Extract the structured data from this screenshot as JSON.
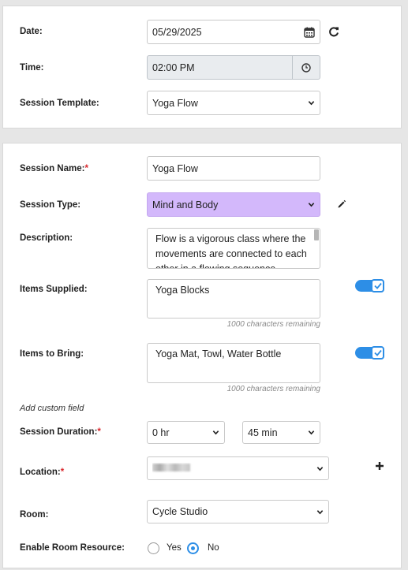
{
  "date": {
    "label": "Date:",
    "value": "05/29/2025"
  },
  "time": {
    "label": "Time:",
    "value": "02:00 PM"
  },
  "template": {
    "label": "Session Template:",
    "value": "Yoga Flow"
  },
  "session_name": {
    "label": "Session Name:",
    "required": "*",
    "value": "Yoga Flow"
  },
  "session_type": {
    "label": "Session Type:",
    "value": "Mind and Body",
    "highlight_color": "#d3b8fb"
  },
  "description": {
    "label": "Description:",
    "value": "Flow is a vigorous class where the movements are connected to each other in a flowing sequence synchronized with the breath."
  },
  "items_supplied": {
    "label": "Items Supplied:",
    "value": "Yoga Blocks",
    "remaining": "1000 characters remaining",
    "enabled": true
  },
  "items_to_bring": {
    "label": "Items to Bring:",
    "value": "Yoga Mat, Towl, Water Bottle",
    "remaining": "1000 characters remaining",
    "enabled": true
  },
  "custom_field": {
    "label": "Add custom field"
  },
  "duration": {
    "label": "Session Duration:",
    "required": "*",
    "hours": "0 hr",
    "minutes": "45 min"
  },
  "location": {
    "label": "Location:",
    "required": "*"
  },
  "room": {
    "label": "Room:",
    "value": "Cycle Studio"
  },
  "room_resource": {
    "label": "Enable Room Resource:",
    "yes": "Yes",
    "no": "No",
    "selected": "No"
  },
  "colors": {
    "accent": "#2d8ee6",
    "required": "#d9262b"
  }
}
